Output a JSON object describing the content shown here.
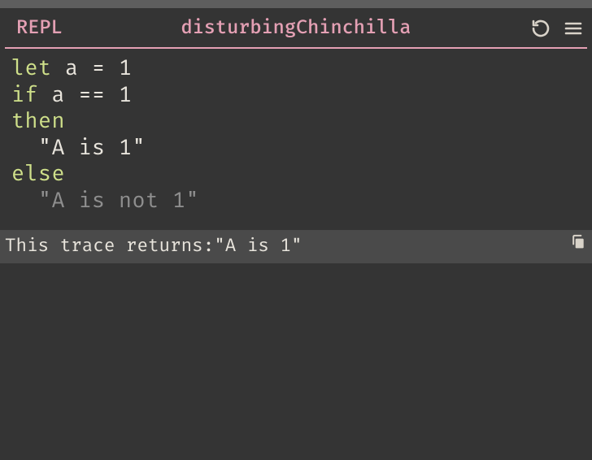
{
  "header": {
    "repl_label": "REPL",
    "session_name": "disturbingChinchilla"
  },
  "icons": {
    "refresh": "refresh-icon",
    "menu": "menu-icon",
    "copy": "copy-icon"
  },
  "code": {
    "lines": [
      {
        "tokens": [
          {
            "t": "let ",
            "c": "kw"
          },
          {
            "t": "a = 1",
            "c": "tok"
          }
        ]
      },
      {
        "tokens": [
          {
            "t": "if ",
            "c": "kw"
          },
          {
            "t": "a == 1",
            "c": "tok"
          }
        ]
      },
      {
        "tokens": [
          {
            "t": "then",
            "c": "kw"
          }
        ]
      },
      {
        "tokens": [
          {
            "t": "  \"A is 1\"",
            "c": "tok"
          }
        ]
      },
      {
        "tokens": [
          {
            "t": "else",
            "c": "kw"
          }
        ]
      },
      {
        "tokens": [
          {
            "t": "  \"A is not 1\"",
            "c": "dim"
          }
        ]
      }
    ]
  },
  "result": {
    "prefix": "This trace returns: ",
    "value": "\"A is 1\""
  },
  "colors": {
    "bg": "#343434",
    "pink": "#e4a0b4",
    "keyword": "#cfe08a",
    "dim": "#8e8e8e",
    "result_bg": "#4a4a4a"
  }
}
